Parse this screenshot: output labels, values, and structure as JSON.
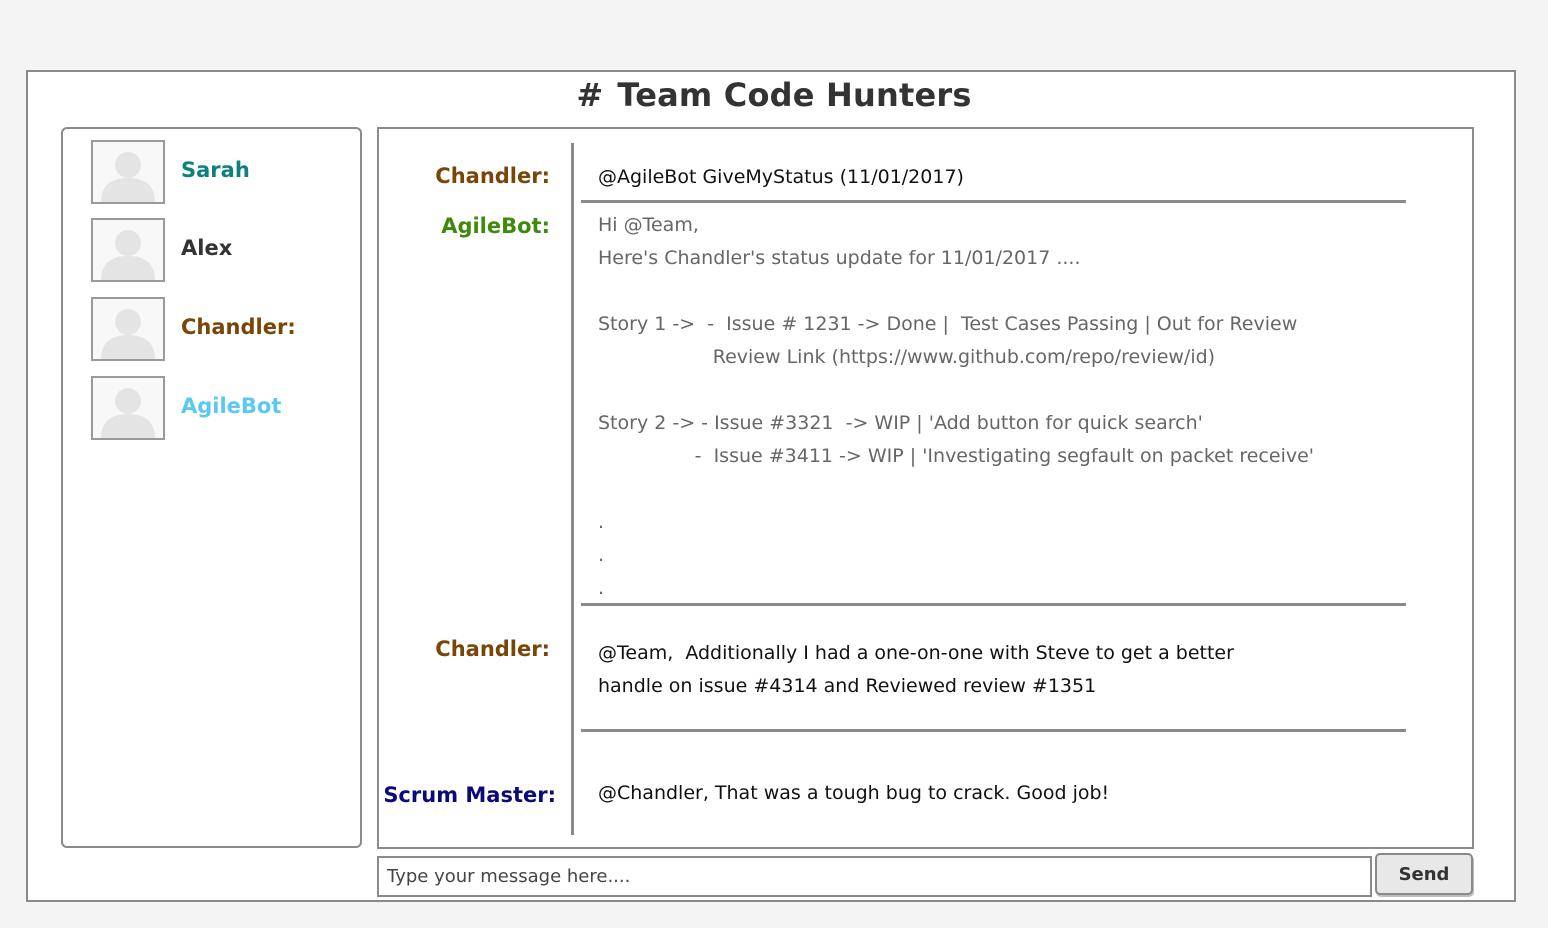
{
  "channel": {
    "hash": "#",
    "name": "Team Code Hunters"
  },
  "sidebar": {
    "users": [
      {
        "name": "Sarah",
        "color": "#0f7f80"
      },
      {
        "name": "Alex",
        "color": "#333333"
      },
      {
        "name": "Chandler:",
        "color": "#7a4607"
      },
      {
        "name": "AgileBot",
        "color": "#5ac8f5"
      }
    ]
  },
  "messages": [
    {
      "sender": "Chandler:",
      "sender_color": "#7a4607",
      "lines": [
        "@AgileBot GiveMyStatus (11/01/2017)"
      ]
    },
    {
      "sender": "AgileBot:",
      "sender_color": "#3f8a0a",
      "lines": [
        "Hi @Team,",
        "Here's Chandler's status update for 11/01/2017 ....",
        "",
        "Story 1 ->  -  Issue # 1231 -> Done |  Test Cases Passing | Out for Review",
        "                   Review Link (https://www.github.com/repo/review/id)",
        "",
        "Story 2 -> - Issue #3321  -> WIP | 'Add button for quick search'",
        "                -  Issue #3411 -> WIP | 'Investigating segfault on packet receive'",
        "",
        ".",
        ".",
        "."
      ]
    },
    {
      "sender": "Chandler:",
      "sender_color": "#7a4607",
      "lines": [
        "@Team,  Additionally I had a one-on-one with Steve to get a better",
        "handle on issue #4314 and Reviewed review #1351"
      ]
    },
    {
      "sender": "Scrum Master:",
      "sender_color": "#0a0a78",
      "lines": [
        "@Chandler, That was a tough bug to crack. Good job!"
      ]
    }
  ],
  "composer": {
    "placeholder": "Type your message here....",
    "send_label": "Send"
  }
}
